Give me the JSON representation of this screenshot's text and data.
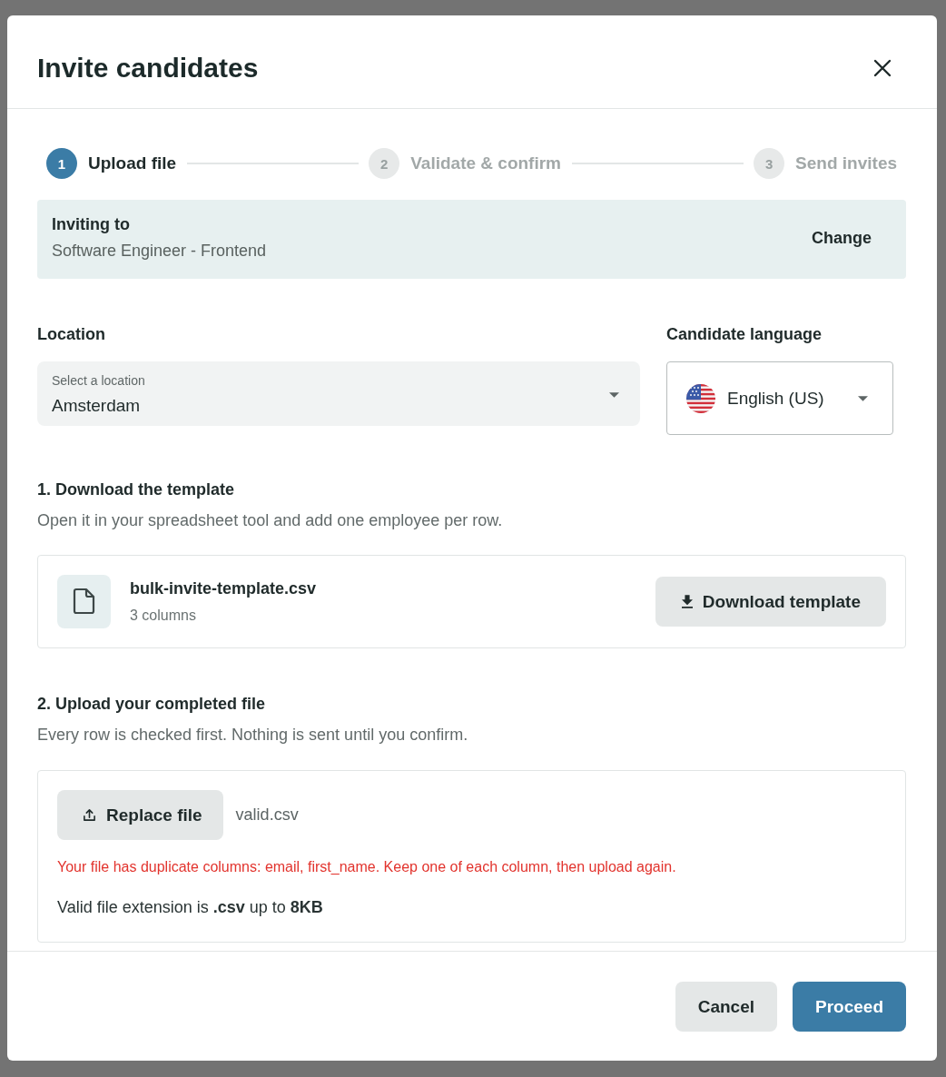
{
  "dialog": {
    "title": "Invite candidates"
  },
  "steps": [
    {
      "number": "1",
      "label": "Upload file",
      "selected": true
    },
    {
      "number": "2",
      "label": "Validate & confirm",
      "selected": false
    },
    {
      "number": "3",
      "label": "Send invites",
      "selected": false
    }
  ],
  "inviting": {
    "label": "Inviting to",
    "value": "Software Engineer - Frontend",
    "action": "Change"
  },
  "location": {
    "label": "Location",
    "floating_label": "Select a location",
    "value": "Amsterdam"
  },
  "language": {
    "label": "Candidate language",
    "value": "English (US)"
  },
  "template_section": {
    "heading": "1. Download the template",
    "description": "Open it in your spreadsheet tool and add one employee per row.",
    "file_name": "bulk-invite-template.csv",
    "file_meta": "3 columns",
    "button": "Download template"
  },
  "upload_section": {
    "heading": "2. Upload your completed file",
    "description": "Every row is checked first. Nothing is sent until you confirm.",
    "button": "Replace file",
    "file_name": "valid.csv",
    "error": "Your file has duplicate columns: email, first_name. Keep one of each column, then upload again.",
    "hint": "Valid file extension is **.csv** up to **8KB**"
  },
  "footer": {
    "cancel_button": "Cancel",
    "proceed_button": "Proceed"
  }
}
